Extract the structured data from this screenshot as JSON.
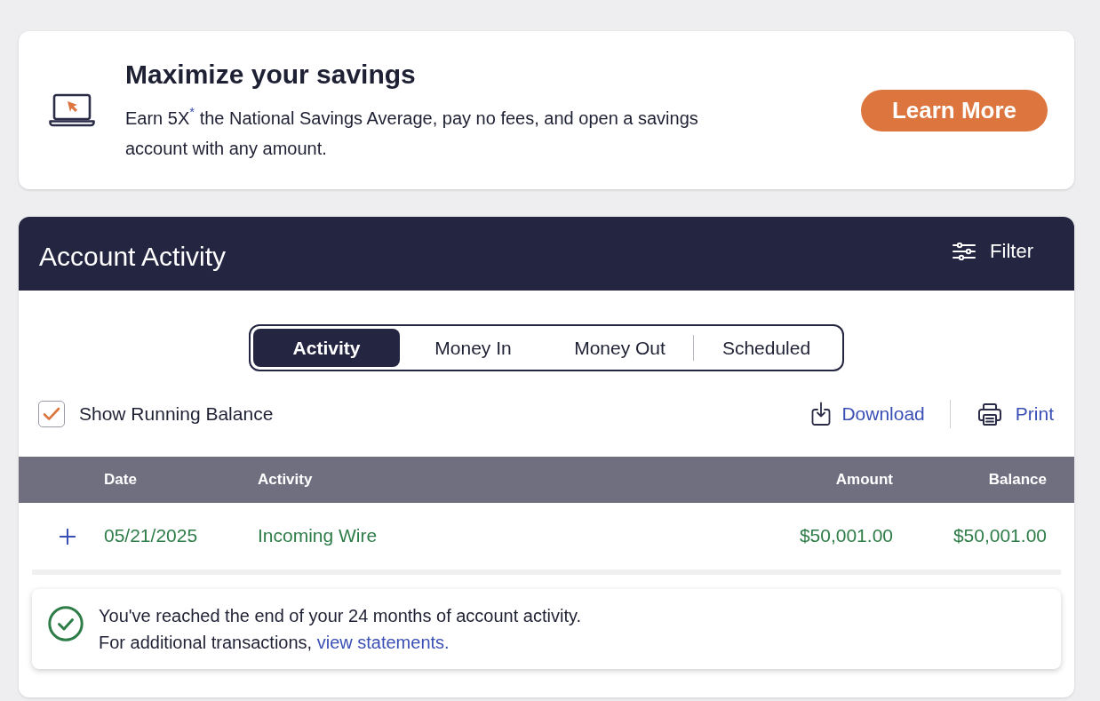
{
  "promo": {
    "title": "Maximize your savings",
    "text": "Earn 5X$^{*}$ the National Savings Average, pay no fees, and open a savings account with any amount.",
    "button": "Learn More"
  },
  "activity_panel": {
    "title": "Account Activity",
    "filter_button": "Filter",
    "tabs": [
      {
        "label": "Activity",
        "selected": true
      },
      {
        "label": "Money In",
        "selected": false
      },
      {
        "label": "Money Out",
        "selected": false
      },
      {
        "label": "Scheduled",
        "selected": false
      }
    ],
    "running_balance": {
      "label": "Show Running Balance",
      "checked": true
    },
    "actions": [
      {
        "kind": "download",
        "label": "Download"
      },
      {
        "kind": "print",
        "label": "Print"
      }
    ],
    "table": {
      "columns": [
        "Date",
        "Activity",
        "Amount",
        "Balance"
      ],
      "rows": [
        {
          "kind": "credit",
          "expanded": false,
          "date": "05/21/2025",
          "activity": "Incoming Wire",
          "amount": "$50,001.00",
          "balance": "$50,001.00"
        }
      ]
    },
    "notice": {
      "text": "You've reached the end of your 24 months of account activity.",
      "prompt": "For additional transactions,",
      "link": "view statements."
    }
  }
}
